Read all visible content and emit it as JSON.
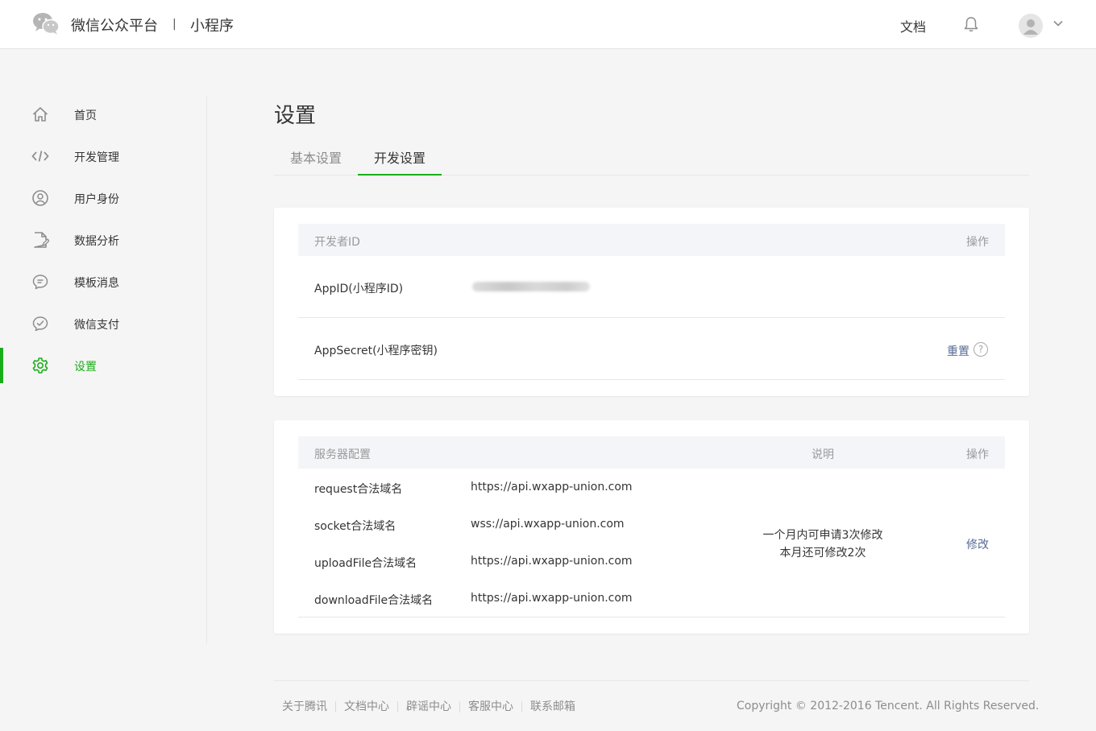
{
  "header": {
    "brand": "微信公众平台",
    "separator": "|",
    "product": "小程序",
    "docs": "文档"
  },
  "sidebar": {
    "items": [
      {
        "label": "首页",
        "icon": "home-icon"
      },
      {
        "label": "开发管理",
        "icon": "code-icon"
      },
      {
        "label": "用户身份",
        "icon": "user-circle-icon"
      },
      {
        "label": "数据分析",
        "icon": "document-edit-icon"
      },
      {
        "label": "模板消息",
        "icon": "chat-bubble-icon"
      },
      {
        "label": "微信支付",
        "icon": "payment-icon"
      },
      {
        "label": "设置",
        "icon": "gear-icon",
        "active": true
      }
    ]
  },
  "main": {
    "title": "设置",
    "tabs": [
      {
        "label": "基本设置"
      },
      {
        "label": "开发设置",
        "active": true
      }
    ],
    "developer": {
      "header_left": "开发者ID",
      "header_right": "操作",
      "appid_label": "AppID(小程序ID)",
      "secret_label": "AppSecret(小程序密钥)",
      "reset_label": "重置",
      "help": "?"
    },
    "server": {
      "header_left": "服务器配置",
      "header_mid": "说明",
      "header_right": "操作",
      "rows": [
        {
          "name": "request合法域名",
          "value": "https://api.wxapp-union.com"
        },
        {
          "name": "socket合法域名",
          "value": "wss://api.wxapp-union.com"
        },
        {
          "name": "uploadFile合法域名",
          "value": "https://api.wxapp-union.com"
        },
        {
          "name": "downloadFile合法域名",
          "value": "https://api.wxapp-union.com"
        }
      ],
      "note_line1": "一个月内可申请3次修改",
      "note_line2": "本月还可修改2次",
      "modify_label": "修改"
    }
  },
  "footer": {
    "links": [
      "关于腾讯",
      "文档中心",
      "辟谣中心",
      "客服中心",
      "联系邮箱"
    ],
    "copyright": "Copyright © 2012-2016 Tencent. All Rights Reserved."
  },
  "colors": {
    "accent": "#1aad19",
    "link": "#576b95",
    "muted": "#8d8d8d"
  }
}
